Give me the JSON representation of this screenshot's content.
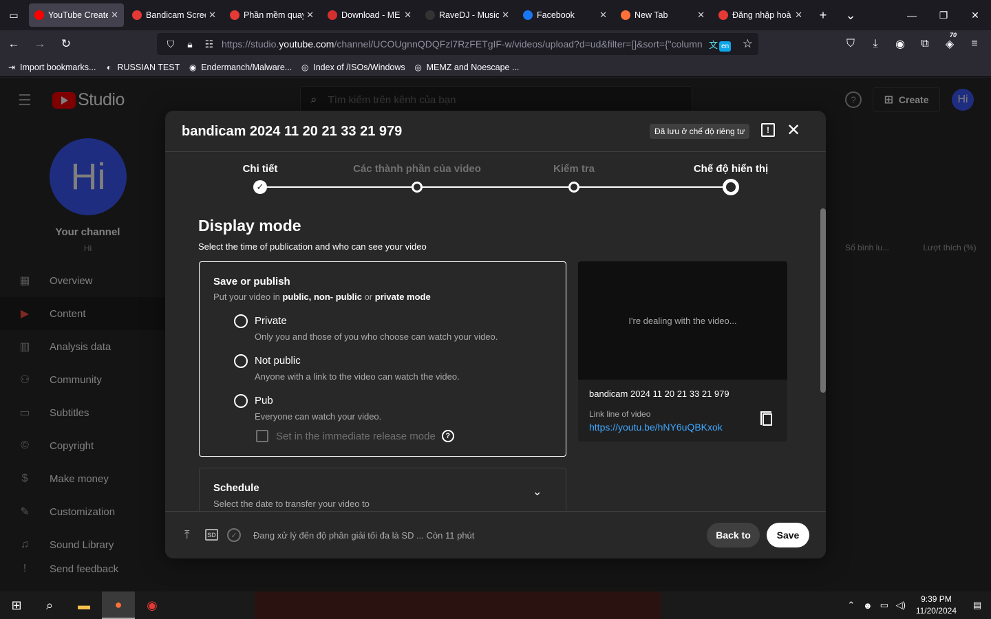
{
  "browser": {
    "tabs": [
      {
        "label": "YouTube Create",
        "color": "#ff0000",
        "active": true
      },
      {
        "label": "Bandicam Scree",
        "color": "#e53935",
        "active": false
      },
      {
        "label": "Phần mềm quay",
        "color": "#e53935",
        "active": false
      },
      {
        "label": "Download - ME",
        "color": "#d32f2f",
        "active": false
      },
      {
        "label": "RaveDJ - Music",
        "color": "#333333",
        "active": false
      },
      {
        "label": "Facebook",
        "color": "#1877f2",
        "active": false
      },
      {
        "label": "New Tab",
        "color": "#ff7139",
        "active": false
      },
      {
        "label": "Đăng nhập hoà",
        "color": "#e53935",
        "active": false
      }
    ],
    "url_prefix": "https://studio.",
    "url_domain": "youtube.com",
    "url_suffix": "/channel/UCOUgnnQDQFzl7RzFETgIF-w/videos/upload?d=ud&filter=[]&sort={\"column",
    "translate_badge": "en",
    "extensions_badge": "70",
    "bookmarks": [
      {
        "label": "Import bookmarks...",
        "icon": "import-icon"
      },
      {
        "label": "RUSSIAN TEST",
        "icon": "russian-test-icon"
      },
      {
        "label": "Endermanch/Malware...",
        "icon": "github-icon"
      },
      {
        "label": "Index of /ISOs/Windows",
        "icon": "globe-icon"
      },
      {
        "label": "MEMZ and Noescape ...",
        "icon": "globe-icon"
      }
    ]
  },
  "studio": {
    "logo_text": "Studio",
    "search_placeholder": "Tìm kiếm trên kênh của bạn",
    "create_label": "Create",
    "avatar_initials": "Hi",
    "channel_title": "Your channel",
    "channel_sub": "Hi",
    "sidebar": [
      {
        "label": "Overview",
        "icon": "dashboard-icon",
        "active": false
      },
      {
        "label": "Content",
        "icon": "content-icon",
        "active": true
      },
      {
        "label": "Analysis data",
        "icon": "analytics-icon",
        "active": false
      },
      {
        "label": "Community",
        "icon": "community-icon",
        "active": false
      },
      {
        "label": "Subtitles",
        "icon": "subtitles-icon",
        "active": false
      },
      {
        "label": "Copyright",
        "icon": "copyright-icon",
        "active": false
      },
      {
        "label": "Make money",
        "icon": "monetization-icon",
        "active": false
      },
      {
        "label": "Customization",
        "icon": "customization-icon",
        "active": false
      },
      {
        "label": "Sound Library",
        "icon": "audio-library-icon",
        "active": false
      },
      {
        "label": "Send feedback",
        "icon": "feedback-icon",
        "active": false
      }
    ],
    "table_headers": [
      "Số bình lu...",
      "Lượt thích (%)"
    ]
  },
  "dialog": {
    "title": "bandicam 2024 11 20 21 33 21 979",
    "saved_badge": "Đã lưu ở chế độ riêng tư",
    "steps": [
      {
        "label": "Chi tiết",
        "state": "done"
      },
      {
        "label": "Các thành phần của video",
        "state": "pending"
      },
      {
        "label": "Kiểm tra",
        "state": "pending"
      },
      {
        "label": "Chế độ hiển thị",
        "state": "current"
      }
    ],
    "section_title": "Display mode",
    "section_sub": "Select the time of publication and who can see your video",
    "publish": {
      "title": "Save or publish",
      "desc_prefix": "Put your video in ",
      "desc_bold1": "public, non- public",
      "desc_mid": " or ",
      "desc_bold2": "private mode",
      "options": [
        {
          "label": "Private",
          "desc": "Only you and those of you who choose can watch your video."
        },
        {
          "label": "Not public",
          "desc": "Anyone with a link to the video can watch the video."
        },
        {
          "label": "Pub",
          "desc": "Everyone can watch your video."
        }
      ],
      "immediate_label": "Set in the immediate release mode"
    },
    "schedule": {
      "title": "Schedule",
      "desc": "Select the date to transfer your video to"
    },
    "preview": {
      "processing": "I're dealing with the video...",
      "name": "bandicam 2024 11 20 21 33 21 979",
      "link_label": "Link line of video",
      "link": "https://youtu.be/hNY6uQBKxok"
    },
    "footer": {
      "sd_label": "SD",
      "status": "Đang xử lý đến độ phân giải tối đa là SD ... Còn 11 phút",
      "back_label": "Back to",
      "save_label": "Save"
    }
  },
  "taskbar": {
    "time": "9:39 PM",
    "date": "11/20/2024"
  }
}
